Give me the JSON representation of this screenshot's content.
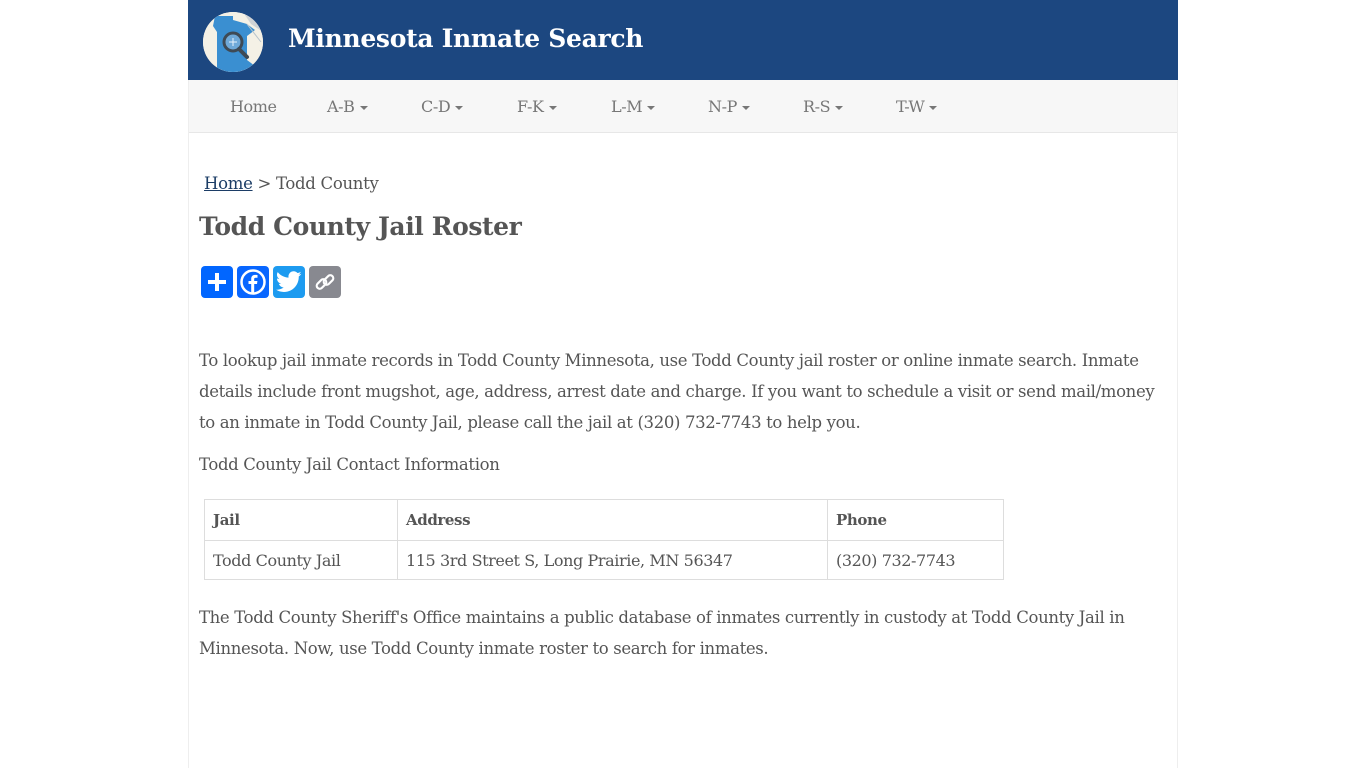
{
  "header": {
    "site_title": "Minnesota Inmate Search",
    "logo_icon": "minnesota-map-magnifier-icon",
    "bg_color": "#1c4780"
  },
  "nav": {
    "items": [
      {
        "label": "Home",
        "dropdown": false
      },
      {
        "label": "A-B",
        "dropdown": true
      },
      {
        "label": "C-D",
        "dropdown": true
      },
      {
        "label": "F-K",
        "dropdown": true
      },
      {
        "label": "L-M",
        "dropdown": true
      },
      {
        "label": "N-P",
        "dropdown": true
      },
      {
        "label": "R-S",
        "dropdown": true
      },
      {
        "label": "T-W",
        "dropdown": true
      }
    ]
  },
  "breadcrumb": {
    "home": "Home",
    "separator": ">",
    "current": "Todd County"
  },
  "page_title": "Todd County Jail Roster",
  "share": {
    "buttons": [
      {
        "name": "share",
        "icon": "plus-icon",
        "color": "#0166ff"
      },
      {
        "name": "facebook",
        "icon": "facebook-icon",
        "color": "#0866ff"
      },
      {
        "name": "twitter",
        "icon": "twitter-icon",
        "color": "#1d9bf0"
      },
      {
        "name": "copy-link",
        "icon": "link-icon",
        "color": "#888990"
      }
    ]
  },
  "intro_paragraph": "To lookup jail inmate records in Todd County Minnesota, use Todd County jail roster or online inmate search. Inmate details include front mugshot, age, address, arrest date and charge. If you want to schedule a visit or send mail/money to an inmate in Todd County Jail, please call the jail at (320) 732-7743 to help you.",
  "contact_title": "Todd County Jail Contact Information",
  "contact_table": {
    "headers": [
      "Jail",
      "Address",
      "Phone"
    ],
    "rows": [
      [
        "Todd County Jail",
        "115 3rd Street S, Long Prairie, MN 56347",
        "(320) 732-7743"
      ]
    ]
  },
  "closing_paragraph": "The Todd County Sheriff's Office maintains a public database of inmates currently in custody at Todd County Jail in Minnesota. Now, use Todd County inmate roster to search for inmates."
}
